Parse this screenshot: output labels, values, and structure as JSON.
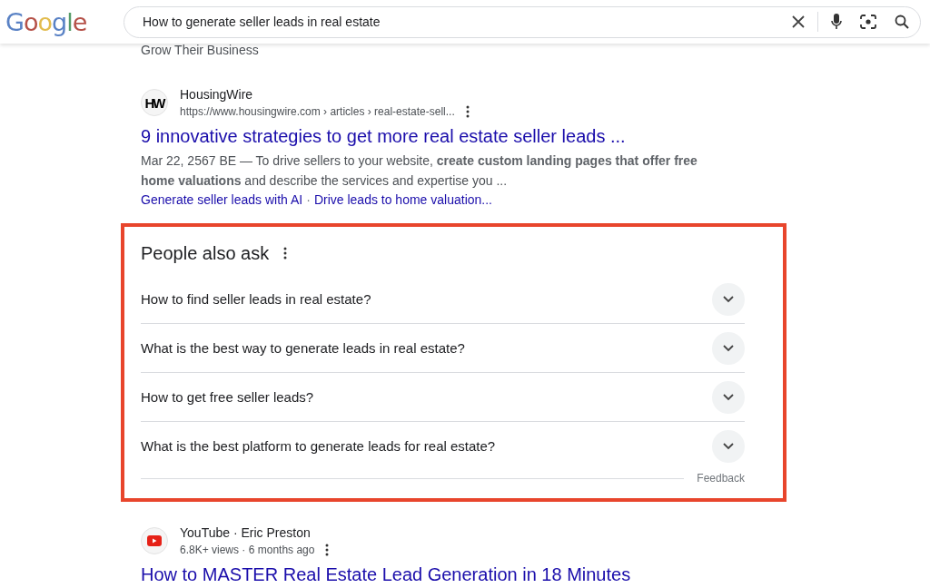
{
  "header": {
    "logo": "Google",
    "search": {
      "value": "How to generate seller leads in real estate"
    }
  },
  "partial_text": "Grow Their Business",
  "results_top": [
    {
      "kind": "site",
      "source": "HousingWire",
      "favicon": "HW",
      "url": "https://www.housingwire.com › articles › real-estate-sell...",
      "title": "9 innovative strategies to get more real estate seller leads ...",
      "snippet": "Mar 22, 2567 BE — To drive sellers to your website, **create custom landing pages that offer free home valuations** and describe the services and expertise you ...",
      "sitelinks": [
        "Generate seller leads with AI",
        "Drive leads to home valuation..."
      ],
      "sitelink_separator": "·"
    }
  ],
  "people_also_ask": {
    "title": "People also ask",
    "questions": [
      {
        "text": "How to find seller leads in real estate?",
        "expanded": false
      },
      {
        "text": "What is the best way to generate leads in real estate?",
        "expanded": false
      },
      {
        "text": "How to get free seller leads?",
        "expanded": false
      },
      {
        "text": "What is the best platform to generate leads for real estate?",
        "expanded": false
      }
    ],
    "feedback": "Feedback"
  },
  "results_bottom": [
    {
      "kind": "video",
      "source": "YouTube · Eric Preston",
      "meta": "6.8K+ views · 6 months ago",
      "title": "How to MASTER Real Estate Lead Generation in 18 Minutes"
    }
  ]
}
